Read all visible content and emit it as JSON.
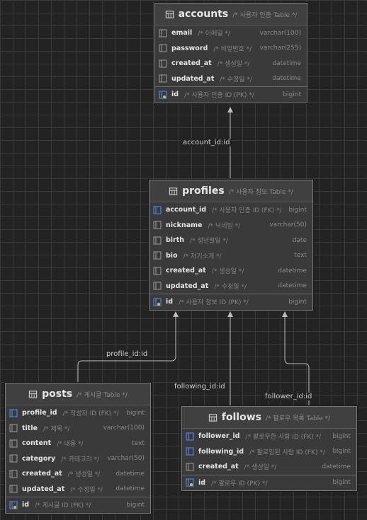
{
  "edges": {
    "account": "account_id:id",
    "profile": "profile_id:id",
    "following": "following_id:id",
    "follower": "follower_id:id"
  },
  "colors": {
    "key_icon": "#4a7fd6",
    "key_accent": "#e8b83a",
    "line": "#bdbdbd"
  },
  "tables": {
    "accounts": {
      "name": "accounts",
      "comment": "/* 사용자 인증 Table */",
      "fields": [
        {
          "name": "email",
          "comment": "/* 이메일 */",
          "type": "varchar(100)",
          "icon": "field-icon"
        },
        {
          "name": "password",
          "comment": "/* 비밀번호 */",
          "type": "varchar(255)",
          "icon": "field-icon"
        },
        {
          "name": "created_at",
          "comment": "/* 생성일 */",
          "type": "datetime",
          "icon": "field-icon"
        },
        {
          "name": "updated_at",
          "comment": "/* 수정일 */",
          "type": "datetime",
          "icon": "field-icon"
        }
      ],
      "pk": {
        "name": "id",
        "comment": "/* 사용자 인증 ID (PK) */",
        "type": "bigint",
        "icon": "primary-key-icon"
      }
    },
    "profiles": {
      "name": "profiles",
      "comment": "/* 사용자 정보 Table */",
      "fields": [
        {
          "name": "account_id",
          "comment": "/* 사용자 인증 ID (FK) */",
          "type": "bigint",
          "icon": "foreign-key-icon"
        },
        {
          "name": "nickname",
          "comment": "/* 닉네임 */",
          "type": "varchar(50)",
          "icon": "field-icon"
        },
        {
          "name": "birth",
          "comment": "/* 생년월일 */",
          "type": "date",
          "icon": "field-icon"
        },
        {
          "name": "bio",
          "comment": "/* 자기소개 */",
          "type": "text",
          "icon": "field-icon"
        },
        {
          "name": "created_at",
          "comment": "/* 생성일 */",
          "type": "datetime",
          "icon": "field-icon"
        },
        {
          "name": "updated_at",
          "comment": "/* 수정일 */",
          "type": "datetime",
          "icon": "field-icon"
        }
      ],
      "pk": {
        "name": "id",
        "comment": "/* 사용자 정보 ID (PK) */",
        "type": "bigint",
        "icon": "primary-key-icon"
      }
    },
    "posts": {
      "name": "posts",
      "comment": "/* 게시글 Table */",
      "fields": [
        {
          "name": "profile_id",
          "comment": "/* 작성자 ID (FK) */",
          "type": "bigint",
          "icon": "foreign-key-icon"
        },
        {
          "name": "title",
          "comment": "/* 제목 */",
          "type": "varchar(100)",
          "icon": "field-icon"
        },
        {
          "name": "content",
          "comment": "/* 내용 */",
          "type": "text",
          "icon": "field-icon"
        },
        {
          "name": "category",
          "comment": "/* 카테고리 */",
          "type": "varchar(50)",
          "icon": "field-icon"
        },
        {
          "name": "created_at",
          "comment": "/* 생성일 */",
          "type": "datetime",
          "icon": "field-icon"
        },
        {
          "name": "updated_at",
          "comment": "/* 수정일 */",
          "type": "datetime",
          "icon": "field-icon"
        }
      ],
      "pk": {
        "name": "id",
        "comment": "/* 게시글 ID (PK) */",
        "type": "bigint",
        "icon": "primary-key-icon"
      }
    },
    "follows": {
      "name": "follows",
      "comment": "/* 팔로우 목록 Table */",
      "fields": [
        {
          "name": "follower_id",
          "comment": "/* 팔로우한 사람 ID (FK) */",
          "type": "bigint",
          "icon": "foreign-key-icon"
        },
        {
          "name": "following_id",
          "comment": "/* 팔로잉된 사람 ID (FK) */",
          "type": "bigint",
          "icon": "foreign-key-icon"
        },
        {
          "name": "created_at",
          "comment": "/* 생성일 */",
          "type": "datetime",
          "icon": "field-icon"
        }
      ],
      "pk": {
        "name": "id",
        "comment": "/* 팔로우 ID (PK) */",
        "type": "bigint",
        "icon": "primary-key-icon"
      }
    }
  }
}
